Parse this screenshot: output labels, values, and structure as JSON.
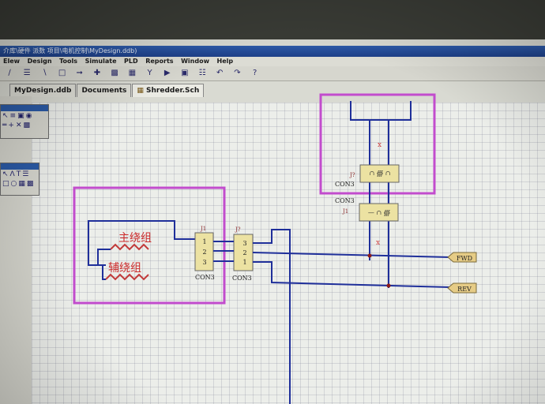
{
  "window": {
    "title": "介库\\硬件  派数  项目\\电机控制\\MyDesign.ddb)"
  },
  "menu": [
    "Elew",
    "Design",
    "Tools",
    "Simulate",
    "PLD",
    "Reports",
    "Window",
    "Help"
  ],
  "toolbar_icons": [
    "wire-icon",
    "bus-icon",
    "line-icon",
    "rect-icon",
    "arrow-icon",
    "cross-icon",
    "chip-icon",
    "lib-icon",
    "probe-icon",
    "run-icon",
    "fill-icon",
    "grid-icon",
    "undo-icon",
    "redo-icon",
    "help-icon"
  ],
  "tabs": [
    {
      "label": "MyDesign.ddb"
    },
    {
      "label": "Documents"
    },
    {
      "label": "Shredder.Sch",
      "icon": "schematic-icon"
    }
  ],
  "schematic": {
    "winding_labels": [
      "主绕组",
      "辅绕组"
    ],
    "connectors": [
      {
        "designator": "J1",
        "part": "CON3",
        "pins": [
          "1",
          "2",
          "3"
        ]
      },
      {
        "designator": "J?",
        "part": "CON3",
        "pins": [
          "3",
          "2",
          "1"
        ]
      },
      {
        "designator": "J?",
        "part": "CON3",
        "pins": [
          "∩ ∰ ∩"
        ]
      },
      {
        "designator": "J1",
        "part": "CON3",
        "pins": [
          "— ∩ ∰"
        ]
      }
    ],
    "ports": [
      "FWD",
      "REV"
    ],
    "colors": {
      "frame": "#c24ccd",
      "wire": "#1f2f9a",
      "component": "#ece2a2",
      "text_red": "#cc2a2a"
    }
  }
}
